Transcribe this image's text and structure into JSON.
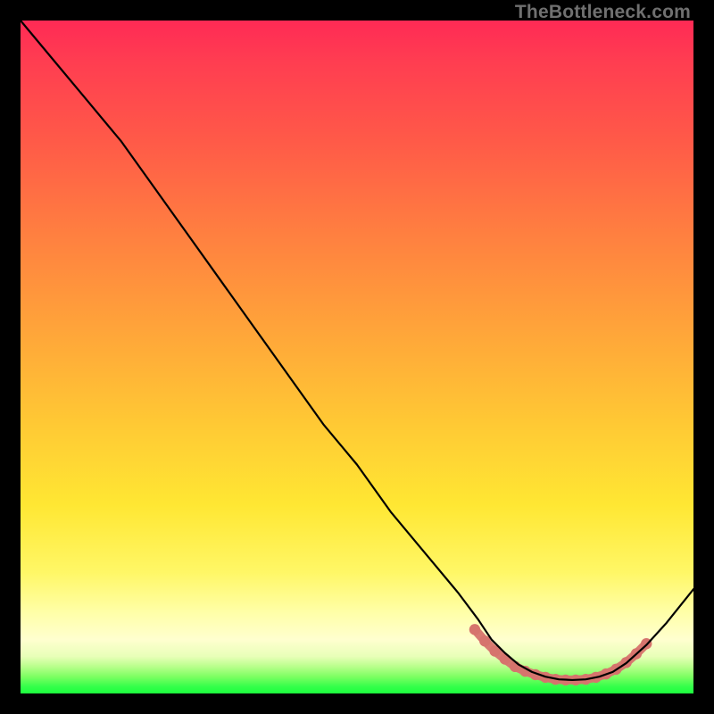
{
  "watermark": "TheBottleneck.com",
  "chart_data": {
    "type": "line",
    "title": "",
    "xlabel": "",
    "ylabel": "",
    "xlim": [
      0,
      100
    ],
    "ylim": [
      0,
      100
    ],
    "series": [
      {
        "name": "bottleneck-curve",
        "color": "#000000",
        "x": [
          0,
          5,
          10,
          15,
          20,
          25,
          30,
          35,
          40,
          45,
          50,
          55,
          60,
          65,
          68,
          70,
          72,
          74,
          76,
          78,
          80,
          82,
          84,
          86,
          88,
          90,
          93,
          96,
          100
        ],
        "values": [
          100,
          94,
          88,
          82,
          75,
          68,
          61,
          54,
          47,
          40,
          34,
          27,
          21,
          15,
          11,
          8,
          6,
          4.3,
          3.2,
          2.5,
          2.1,
          2.0,
          2.1,
          2.5,
          3.2,
          4.5,
          7.2,
          10.5,
          15.5
        ]
      },
      {
        "name": "optimal-range-dots",
        "color": "#d6746d",
        "x": [
          67.5,
          69.0,
          70.5,
          72.0,
          73.5,
          75.0,
          76.5,
          78.0,
          79.5,
          81.0,
          82.5,
          84.0,
          85.5,
          87.0,
          88.5,
          90.0,
          91.5,
          93.0
        ],
        "values": [
          9.5,
          7.8,
          6.3,
          5.1,
          4.0,
          3.3,
          2.8,
          2.4,
          2.1,
          2.0,
          2.0,
          2.1,
          2.4,
          2.9,
          3.6,
          4.6,
          5.9,
          7.4
        ]
      }
    ]
  }
}
